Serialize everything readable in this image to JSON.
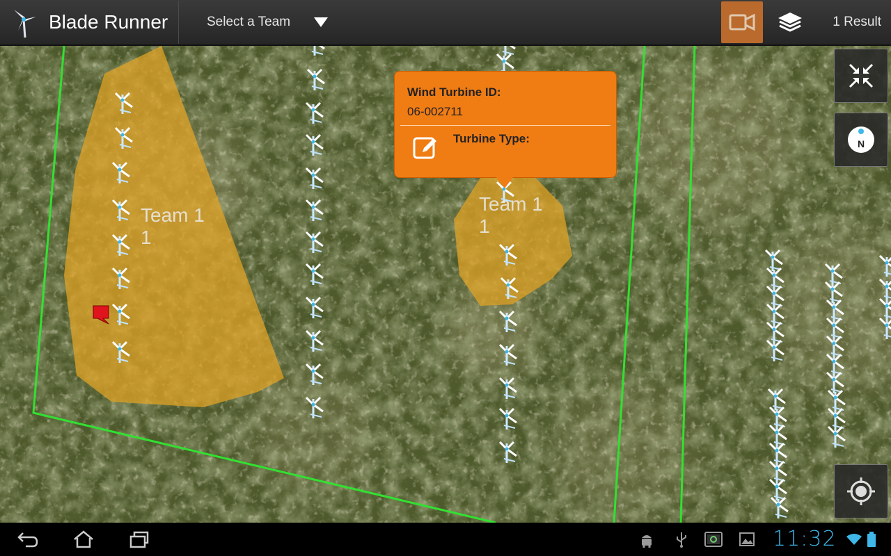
{
  "app": {
    "title": "Blade Runner",
    "team_select_label": "Select a Team",
    "result_count": "1 Result",
    "accent_color": "#b96a2c"
  },
  "map": {
    "team_labels": [
      {
        "text": "Team 1\n1"
      },
      {
        "text": "Team 1\n1"
      }
    ],
    "zone_color": "#e0a326",
    "boundary_color": "#33e032",
    "turbine_icon": "wind-turbine-icon",
    "marker_icon": "red-flag-marker-icon"
  },
  "callout": {
    "id_label": "Wind Turbine ID:",
    "id_value": "06-002711",
    "type_label": "Turbine Type:",
    "color": "#f07c14"
  },
  "controls": {
    "collapse_icon": "collapse-arrows-icon",
    "compass_icon": "compass-icon",
    "locate_icon": "my-location-icon"
  },
  "system_bar": {
    "time": "11:32",
    "clock_color": "#3fb7e8",
    "icons": [
      "back-icon",
      "home-icon",
      "recent-apps-icon",
      "android-debug-icon",
      "usb-icon",
      "screenshot-icon",
      "gallery-icon",
      "wifi-icon",
      "battery-icon"
    ]
  }
}
